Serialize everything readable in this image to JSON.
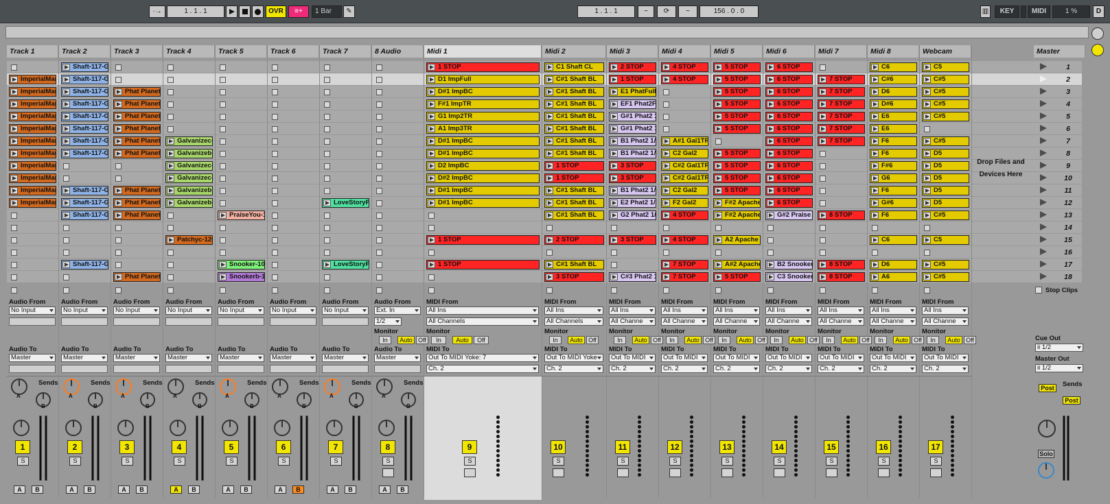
{
  "transport": {
    "follow": "·→",
    "position": "1 . 1 . 1",
    "ovr": "OVR",
    "quantize": "1 Bar",
    "loop_start": "1 . 1 . 1",
    "tempo": "156 . 0 . 0",
    "key": "KEY",
    "midi": "MIDI",
    "cpu": "1 %",
    "d": "D"
  },
  "tracks": [
    {
      "name": "Track 1",
      "num": "1",
      "input_label": "Audio From",
      "input": "No Input",
      "output_label": "Audio To",
      "output": "Master",
      "type": "audio",
      "clips": [
        null,
        "ImperialMar",
        "ImperialMar",
        "ImperialMar",
        "ImperialMar",
        "ImperialMar",
        "ImperialMar",
        "ImperialMar",
        "ImperialMar",
        "ImperialMar",
        "ImperialMar",
        "ImperialMar",
        null,
        null,
        null,
        null,
        null,
        null
      ]
    },
    {
      "name": "Track 2",
      "num": "2",
      "input_label": "Audio From",
      "input": "No Input",
      "output_label": "Audio To",
      "output": "Master",
      "type": "audio",
      "clips": [
        "Shaft-117-G",
        "Shaft-117-G",
        "Shaft-117-G",
        "Shaft-117-G",
        "Shaft-117-G",
        "Shaft-117-G",
        "Shaft-117-G",
        "Shaft-117-G",
        null,
        null,
        "Shaft-117-G",
        "Shaft-117-G",
        "Shaft-117-G",
        null,
        null,
        null,
        "Shaft-117-G",
        null
      ]
    },
    {
      "name": "Track 3",
      "num": "3",
      "input_label": "Audio From",
      "input": "No Input",
      "output_label": "Audio To",
      "output": "Master",
      "type": "audio",
      "clips": [
        null,
        null,
        "Phat Planet",
        "Phat Planet",
        "Phat Planet",
        "Phat Planet",
        "Phat Planet",
        "Phat Planet",
        null,
        null,
        "Phat Planet",
        "Phat Planet",
        "Phat Planet",
        null,
        null,
        null,
        null,
        "Phat Planet"
      ]
    },
    {
      "name": "Track 4",
      "num": "4",
      "input_label": "Audio From",
      "input": "No Input",
      "output_label": "Audio To",
      "output": "Master",
      "type": "audio",
      "clips": [
        null,
        null,
        null,
        null,
        null,
        null,
        "Galvanizec-",
        "Galvanizeb-",
        "Galvanizec-",
        "Galvanizec-",
        "Galvanizeb-",
        "Galvanizeb-",
        null,
        null,
        "Patchyc-126",
        null,
        null,
        null
      ]
    },
    {
      "name": "Track 5",
      "num": "5",
      "input_label": "Audio From",
      "input": "No Input",
      "output_label": "Audio To",
      "output": "Master",
      "type": "audio",
      "clips": [
        null,
        null,
        null,
        null,
        null,
        null,
        null,
        null,
        null,
        null,
        null,
        null,
        "PraiseYou-1",
        null,
        null,
        null,
        "Snooker-102",
        "Snookerb-1"
      ]
    },
    {
      "name": "Track 6",
      "num": "6",
      "input_label": "Audio From",
      "input": "No Input",
      "output_label": "Audio To",
      "output": "Master",
      "type": "audio",
      "clips": [
        null,
        null,
        null,
        null,
        null,
        null,
        null,
        null,
        null,
        null,
        null,
        null,
        null,
        null,
        null,
        null,
        null,
        null
      ]
    },
    {
      "name": "Track 7",
      "num": "7",
      "input_label": "Audio From",
      "input": "No Input",
      "output_label": "Audio To",
      "output": "Master",
      "type": "audio",
      "clips": [
        null,
        null,
        null,
        null,
        null,
        null,
        null,
        null,
        null,
        null,
        null,
        "LoveStoryP",
        null,
        null,
        null,
        null,
        "LoveStoryP",
        null
      ]
    },
    {
      "name": "8 Audio",
      "num": "8",
      "input_label": "Audio From",
      "input": "Ext. In",
      "input_ch": "1/2",
      "output_label": "Audio To",
      "output": "Master",
      "type": "audio",
      "clips": [
        null,
        null,
        null,
        null,
        null,
        null,
        null,
        null,
        null,
        null,
        null,
        null,
        null,
        null,
        null,
        null,
        null,
        null
      ]
    },
    {
      "name": "Midi 1",
      "num": "9",
      "input_label": "MIDI From",
      "input": "All Ins",
      "input_ch": "All Channels",
      "output_label": "MIDI To",
      "output": "Out To MIDI Yoke:  7",
      "output_ch": "Ch. 2",
      "type": "midi",
      "clips": [
        "1 STOP",
        "D1 ImpFull",
        "D#1 ImpBC",
        "F#1 ImpTR",
        "G1 Imp2TR",
        "A1 Imp3TR",
        "D#1 ImpBC",
        "D#1 ImpBC",
        "D2 ImpBC",
        "D#2 ImpBC",
        "D#1 ImpBC",
        "D#1 ImpBC",
        null,
        null,
        "1 STOP",
        null,
        "1 STOP",
        null
      ]
    },
    {
      "name": "Midi 2",
      "num": "10",
      "input_label": "MIDI From",
      "input": "All Ins",
      "input_ch": "All Channels",
      "output_label": "MIDI To",
      "output": "Out To MIDI Yoke",
      "output_ch": "Ch. 2",
      "type": "midi",
      "clips": [
        "C1 Shaft CL",
        "C#1 Shaft BL",
        "C#1 Shaft BL",
        "C#1 Shaft BL",
        "C#1 Shaft BL",
        "C#1 Shaft BL",
        "C#1 Shaft BL",
        "C#1 Shaft BL",
        "1 STOP",
        "1 STOP",
        "C#1 Shaft BL",
        "C#1 Shaft BL",
        "C#1 Shaft BL",
        null,
        "2 STOP",
        null,
        "C#1 Shaft BL",
        "3 STOP"
      ]
    },
    {
      "name": "Midi 3",
      "num": "11",
      "input_label": "MIDI From",
      "input": "All Ins",
      "input_ch": "All Channe",
      "output_label": "MIDI To",
      "output": "Out To MIDI",
      "output_ch": "Ch. 2",
      "type": "midi",
      "clips": [
        "2 STOP",
        "1 STOP",
        "E1 PhatFull",
        "EF1 Phat2F",
        "G#1 Phat2 1",
        "G#1 Phat2 1",
        "B1 Phat2 1/",
        "B1 Phat2 1/",
        "3 STOP",
        "3 STOP",
        "B1 Phat2 1/",
        "E2 Phat2 1/",
        "G2 Phat2 1/",
        null,
        "3 STOP",
        null,
        null,
        "C#3 Phat2 1"
      ]
    },
    {
      "name": "Midi 4",
      "num": "12",
      "input_label": "MIDI From",
      "input": "All Ins",
      "input_ch": "All Channe",
      "output_label": "MIDI To",
      "output": "Out To MIDI",
      "output_ch": "Ch. 2",
      "type": "midi",
      "clips": [
        "4 STOP",
        "4 STOP",
        null,
        null,
        null,
        null,
        "A#1 Gal1TR",
        "C2 Gal2",
        "C#2 Gal1TR",
        "C#2 Gal1TR",
        "C2 Gal2",
        "F2 Gal2",
        "4 STOP",
        null,
        "4 STOP",
        null,
        "7 STOP",
        "7 STOP"
      ]
    },
    {
      "name": "Midi 5",
      "num": "13",
      "input_label": "MIDI From",
      "input": "All Ins",
      "input_ch": "All Channe",
      "output_label": "MIDI To",
      "output": "Out To MIDI",
      "output_ch": "Ch. 2",
      "type": "midi",
      "clips": [
        "5 STOP",
        "5 STOP",
        "5 STOP",
        "5 STOP",
        "5 STOP",
        "5 STOP",
        null,
        "5 STOP",
        "5 STOP",
        "5 STOP",
        "5 STOP",
        "F#2 Apache",
        "F#2 Apache",
        null,
        "A2 Apache",
        null,
        "A#2 Apache",
        "5 STOP"
      ]
    },
    {
      "name": "Midi 6",
      "num": "14",
      "input_label": "MIDI From",
      "input": "All Ins",
      "input_ch": "All Channe",
      "output_label": "MIDI To",
      "output": "Out To MIDI",
      "output_ch": "Ch. 2",
      "type": "midi",
      "clips": [
        "6 STOP",
        "6 STOP",
        "6 STOP",
        "6 STOP",
        "6 STOP",
        "6 STOP",
        "6 STOP",
        "6 STOP",
        "6 STOP",
        "6 STOP",
        "6 STOP",
        "6 STOP",
        "G#2 Praise",
        null,
        null,
        null,
        "B2 Snooker",
        "C3 Snooker"
      ]
    },
    {
      "name": "Midi 7",
      "num": "15",
      "input_label": "MIDI From",
      "input": "All Ins",
      "input_ch": "All Channe",
      "output_label": "MIDI To",
      "output": "Out To MIDI",
      "output_ch": "Ch. 2",
      "type": "midi",
      "clips": [
        null,
        "7 STOP",
        "7 STOP",
        "7 STOP",
        "7 STOP",
        "7 STOP",
        "7 STOP",
        null,
        null,
        null,
        null,
        null,
        "8 STOP",
        null,
        null,
        null,
        "8 STOP",
        "8 STOP"
      ]
    },
    {
      "name": "Midi 8",
      "num": "16",
      "input_label": "MIDI From",
      "input": "All Ins",
      "input_ch": "All Channe",
      "output_label": "MIDI To",
      "output": "Out To MIDI",
      "output_ch": "Ch. 2",
      "type": "midi",
      "clips": [
        "C6",
        "C#6",
        "D6",
        "D#6",
        "E6",
        "E6",
        "F6",
        "F6",
        "F#6",
        "G6",
        "F6",
        "G#6",
        "F6",
        null,
        "C6",
        null,
        "D6",
        "A6"
      ]
    },
    {
      "name": "Webcam",
      "num": "17",
      "input_label": "MIDI From",
      "input": "All Ins",
      "input_ch": "All Channe",
      "output_label": "MIDI To",
      "output": "Out To MIDI",
      "output_ch": "Ch. 2",
      "type": "midi",
      "clips": [
        "C5",
        "C#5",
        "C#5",
        "C#5",
        "C#5",
        null,
        "C#5",
        "D5",
        "D5",
        "D5",
        "D5",
        "D5",
        "C#5",
        null,
        "C5",
        null,
        "C#5",
        "C#5"
      ]
    }
  ],
  "clip_colors": {
    "audio_orange": "#d2691e",
    "audio_blue": "#8fb3e6",
    "audio_green": "#a8d66b",
    "audio_teal": "#4fe0a0",
    "audio_salmon": "#f0b0a0",
    "audio_purple": "#b27ad6",
    "audio_lime": "#7ff07a",
    "stop_red": "#ff2424",
    "midi_yellow": "#e3cb00",
    "midi_lavender": "#d6c6f0"
  },
  "master": {
    "name": "Master",
    "scenes": [
      "1",
      "2",
      "3",
      "4",
      "5",
      "6",
      "7",
      "8",
      "9",
      "10",
      "11",
      "12",
      "13",
      "14",
      "15",
      "16",
      "17",
      "18"
    ],
    "stop_clips": "Stop Clips",
    "cue_out_label": "Cue Out",
    "cue_out": "ii 1/2",
    "master_out_label": "Master Out",
    "master_out": "ii 1/2",
    "post1": "Post",
    "post2": "Post",
    "solo": "Solo"
  },
  "drop": {
    "line1": "Drop Files and",
    "line2": "Devices Here"
  },
  "mixer": {
    "sends": "Sends",
    "send_a": "A",
    "send_b": "B",
    "monitor": "Monitor",
    "mon_in": "In",
    "mon_auto": "Auto",
    "mon_off": "Off",
    "s": "S"
  }
}
